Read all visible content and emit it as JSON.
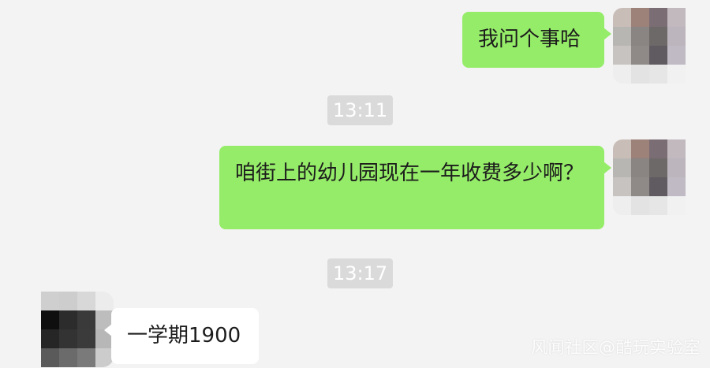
{
  "messages": [
    {
      "side": "out",
      "text": "我问个事哈"
    },
    {
      "side": "time",
      "text": "13:11"
    },
    {
      "side": "out",
      "text": "咱街上的幼儿园现在一年收费多少啊？"
    },
    {
      "side": "time",
      "text": "13:17"
    },
    {
      "side": "in",
      "text": "一学期1900"
    }
  ],
  "watermark": "风闻社区@酷玩实验室",
  "colors": {
    "background": "#f3f3f3",
    "outgoing_bubble": "#95ec69",
    "incoming_bubble": "#ffffff",
    "timestamp_bg": "#dadada"
  },
  "avatars": {
    "self": [
      "#c9bdb8",
      "#9c8279",
      "#7b6d74",
      "#c1b9be",
      "#b8b6b2",
      "#8a8482",
      "#6e6969",
      "#bdb5bd",
      "#c7c3c0",
      "#8f8a88",
      "#5f5b60",
      "#c0bac4",
      "#eeeeee",
      "#e3e3e3",
      "#e6e6e6",
      "#f1f1f1"
    ],
    "other": [
      "#cfcfcf",
      "#cdcdcd",
      "#d8d8d8",
      "#ececec",
      "#0f0f0f",
      "#2c2c2c",
      "#3a3a3a",
      "#bdbdbd",
      "#262626",
      "#333333",
      "#3b3b3b",
      "#b7b7b7",
      "#5a5a5a",
      "#6b6b6b",
      "#7a7a7a",
      "#cccccc"
    ]
  }
}
